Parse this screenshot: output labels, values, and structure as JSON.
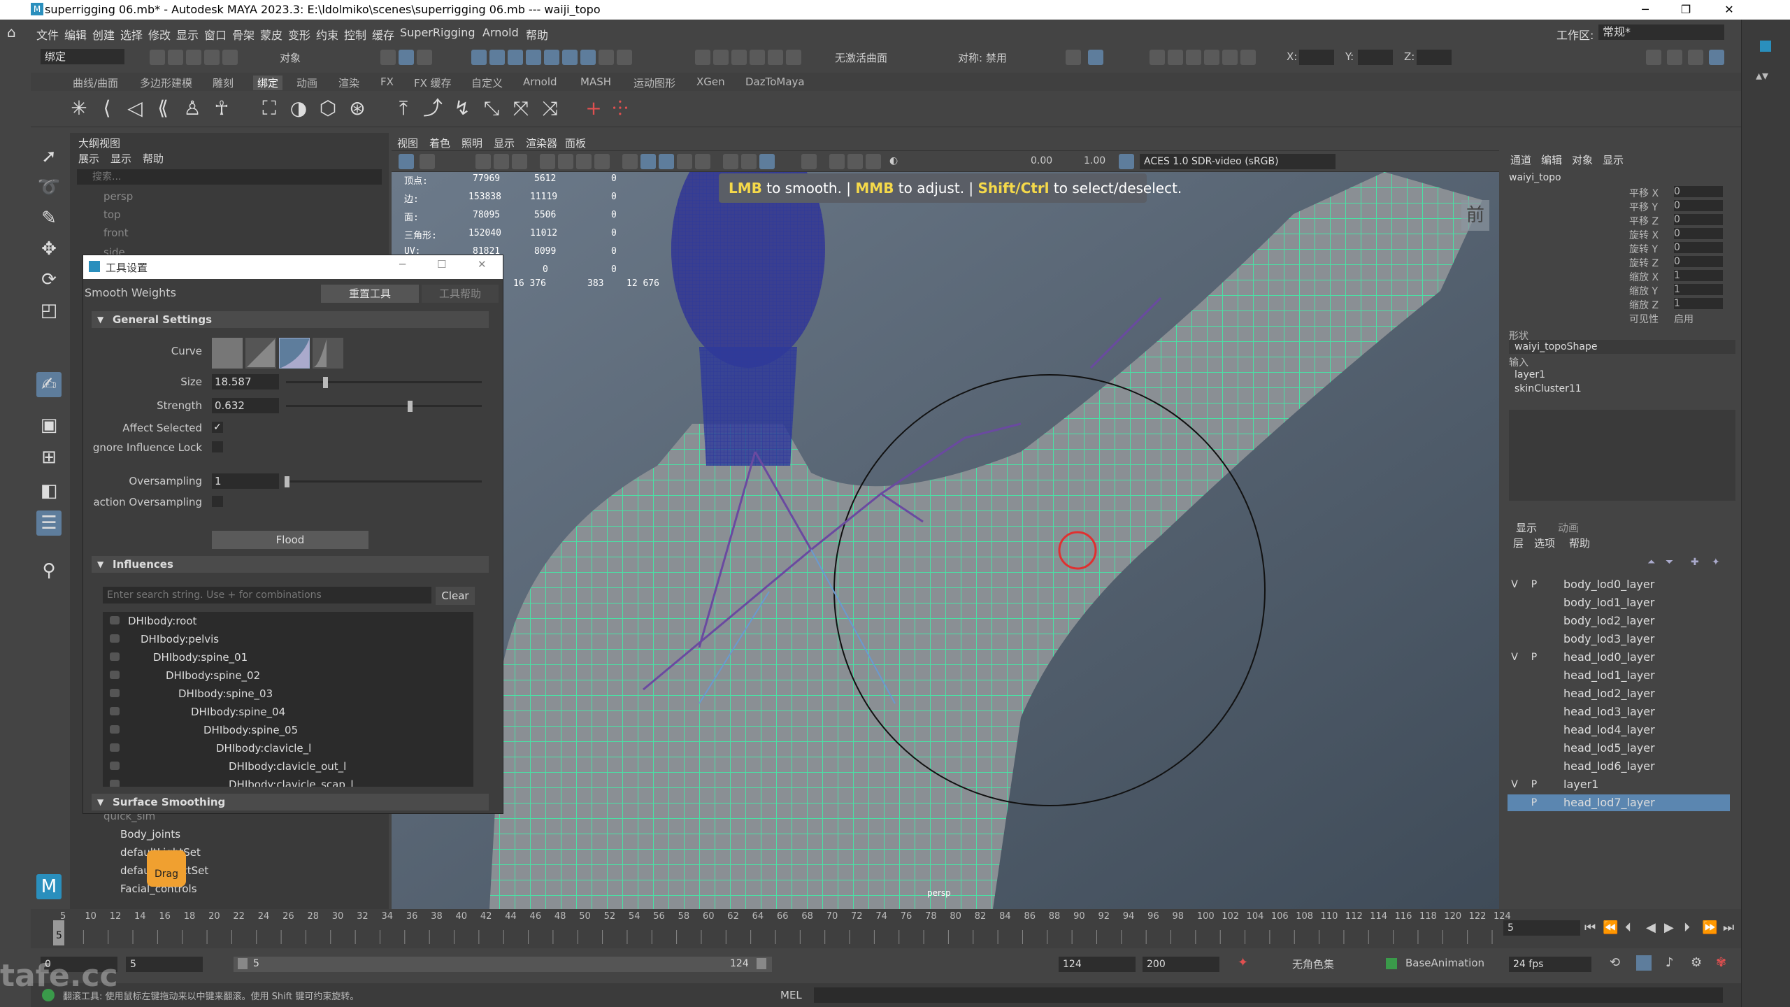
{
  "titlebar": {
    "title": "superrigging 06.mb* - Autodesk MAYA 2023.3: E:\\ldolmiko\\scenes\\superrigging 06.mb   ---   waiji_topo",
    "minimize": "─",
    "maximize": "❐",
    "close": "✕"
  },
  "menu": {
    "items": [
      "文件",
      "编辑",
      "创建",
      "选择",
      "修改",
      "显示",
      "窗口",
      "骨架",
      "蒙皮",
      "变形",
      "约束",
      "控制",
      "缓存",
      "SuperRigging",
      "Arnold",
      "帮助"
    ],
    "workspace_label": "工作区:",
    "workspace_value": "常规*"
  },
  "toolbar": {
    "mode": "绑定",
    "object_label": "对象",
    "no_live_surface": "无激活曲面",
    "symmetry": "对称: 禁用",
    "x_label": "X:",
    "y_label": "Y:",
    "z_label": "Z:"
  },
  "shelf": {
    "tabs": [
      "曲线/曲面",
      "多边形建模",
      "雕刻",
      "绑定",
      "动画",
      "渲染",
      "FX",
      "FX 缓存",
      "自定义",
      "Arnold",
      "MASH",
      "运动图形",
      "XGen",
      "DazToMaya"
    ],
    "active_tab": "绑定"
  },
  "outliner": {
    "title": "大纲视图",
    "menu": [
      "展示",
      "显示",
      "帮助"
    ],
    "search_placeholder": "搜索...",
    "cameras": [
      "persp",
      "top",
      "front",
      "side"
    ],
    "bottom_items": [
      "quick_sim",
      "Body_joints",
      "defaultLightSet",
      "defaultObjectSet",
      "Facial_controls"
    ],
    "drag_label": "Drag"
  },
  "viewport": {
    "menu": [
      "视图",
      "着色",
      "照明",
      "显示",
      "渲染器",
      "面板"
    ],
    "exposure": "0.00",
    "gamma": "1.00",
    "colorspace": "ACES 1.0 SDR-video (sRGB)",
    "hud_labels": [
      "顶点:",
      "边:",
      "面:",
      "三角形:",
      "UV:"
    ],
    "hud_col1": [
      "77969",
      "153838",
      "78095",
      "152040",
      "81821",
      "0",
      "16 376"
    ],
    "hud_col2": [
      "5612",
      "11119",
      "5506",
      "11012",
      "8099",
      "0",
      "383"
    ],
    "hud_col3": [
      "0",
      "0",
      "0",
      "0",
      "0",
      "0",
      "12 676"
    ],
    "view_label": "前",
    "camera_label": "persp",
    "tooltip": {
      "lmb": "LMB",
      "lmb_text": " to smooth. | ",
      "mmb": "MMB",
      "mmb_text": " to adjust. | ",
      "shift": "Shift/Ctrl",
      "shift_text": " to select/deselect."
    }
  },
  "tool_settings": {
    "window_title": "工具设置",
    "tool_name": "Smooth Weights",
    "reset_button": "重置工具",
    "help_button": "工具帮助",
    "general_section": "General Settings",
    "curve_label": "Curve",
    "size_label": "Size",
    "size_value": "18.587",
    "size_fraction": 0.2,
    "strength_label": "Strength",
    "strength_value": "0.632",
    "strength_fraction": 0.632,
    "affect_selected_label": "Affect Selected",
    "ignore_lock_label": "gnore Influence Lock",
    "oversampling_label": "Oversampling",
    "oversampling_value": "1",
    "fraction_label": "action Oversampling",
    "flood_button": "Flood",
    "influences_section": "Influences",
    "search_placeholder": "Enter search string. Use + for combinations",
    "clear_button": "Clear",
    "influences": [
      "DHIbody:root",
      "DHIbody:pelvis",
      "DHIbody:spine_01",
      "DHIbody:spine_02",
      "DHIbody:spine_03",
      "DHIbody:spine_04",
      "DHIbody:spine_05",
      "DHIbody:clavicle_l",
      "DHIbody:clavicle_out_l",
      "DHIbody:clavicle_scap_l"
    ],
    "surface_section": "Surface Smoothing"
  },
  "channel_box": {
    "menu": [
      "通道",
      "编辑",
      "对象",
      "显示"
    ],
    "object": "waiyi_topo",
    "attrs": [
      {
        "name": "平移 X",
        "value": "0"
      },
      {
        "name": "平移 Y",
        "value": "0"
      },
      {
        "name": "平移 Z",
        "value": "0"
      },
      {
        "name": "旋转 X",
        "value": "0"
      },
      {
        "name": "旋转 Y",
        "value": "0"
      },
      {
        "name": "旋转 Z",
        "value": "0"
      },
      {
        "name": "缩放 X",
        "value": "1"
      },
      {
        "name": "缩放 Y",
        "value": "1"
      },
      {
        "name": "缩放 Z",
        "value": "1"
      },
      {
        "name": "可见性",
        "value": "启用"
      }
    ],
    "shapes_label": "形状",
    "shape": "waiyi_topoShape",
    "inputs_label": "输入",
    "inputs": [
      "layer1",
      "skinCluster11"
    ]
  },
  "layer_editor": {
    "tabs": [
      "显示",
      "动画"
    ],
    "menu": [
      "层",
      "选项",
      "帮助"
    ],
    "layers": [
      {
        "v": "V",
        "p": "P",
        "name": "body_lod0_layer"
      },
      {
        "v": "",
        "p": "",
        "name": "body_lod1_layer"
      },
      {
        "v": "",
        "p": "",
        "name": "body_lod2_layer"
      },
      {
        "v": "",
        "p": "",
        "name": "body_lod3_layer"
      },
      {
        "v": "V",
        "p": "P",
        "name": "head_lod0_layer"
      },
      {
        "v": "",
        "p": "",
        "name": "head_lod1_layer"
      },
      {
        "v": "",
        "p": "",
        "name": "head_lod2_layer"
      },
      {
        "v": "",
        "p": "",
        "name": "head_lod3_layer"
      },
      {
        "v": "",
        "p": "",
        "name": "head_lod4_layer"
      },
      {
        "v": "",
        "p": "",
        "name": "head_lod5_layer"
      },
      {
        "v": "",
        "p": "",
        "name": "head_lod6_layer"
      },
      {
        "v": "V",
        "p": "P",
        "name": "layer1"
      },
      {
        "v": "",
        "p": "P",
        "name": "head_lod7_layer"
      }
    ],
    "selected": "head_lod7_layer"
  },
  "timeline": {
    "ticks": [
      "5",
      "10",
      "12",
      "14",
      "16",
      "18",
      "20",
      "22",
      "24",
      "26",
      "28",
      "30",
      "32",
      "34",
      "36",
      "38",
      "40",
      "42",
      "44",
      "46",
      "48",
      "50",
      "52",
      "54",
      "56",
      "58",
      "60",
      "62",
      "64",
      "66",
      "68",
      "70",
      "72",
      "74",
      "76",
      "78",
      "80",
      "82",
      "84",
      "86",
      "88",
      "90",
      "92",
      "94",
      "96",
      "98",
      "100",
      "102",
      "104",
      "106",
      "108",
      "110",
      "112",
      "114",
      "116",
      "118",
      "120",
      "122",
      "124"
    ],
    "current_frame_field": "5",
    "start_marker": "5"
  },
  "range": {
    "anim_start": "0",
    "play_start": "5",
    "slider_start": "5",
    "slider_end": "124",
    "play_end": "124",
    "anim_end": "200",
    "no_char_set": "无角色集",
    "anim_layer": "BaseAnimation",
    "fps": "24 fps"
  },
  "status": {
    "help_text": "翻滚工具: 使用鼠标左键拖动来以中键来翻滚。使用 Shift 键可约束旋转。",
    "mel": "MEL"
  },
  "watermark": "tafe.cc"
}
